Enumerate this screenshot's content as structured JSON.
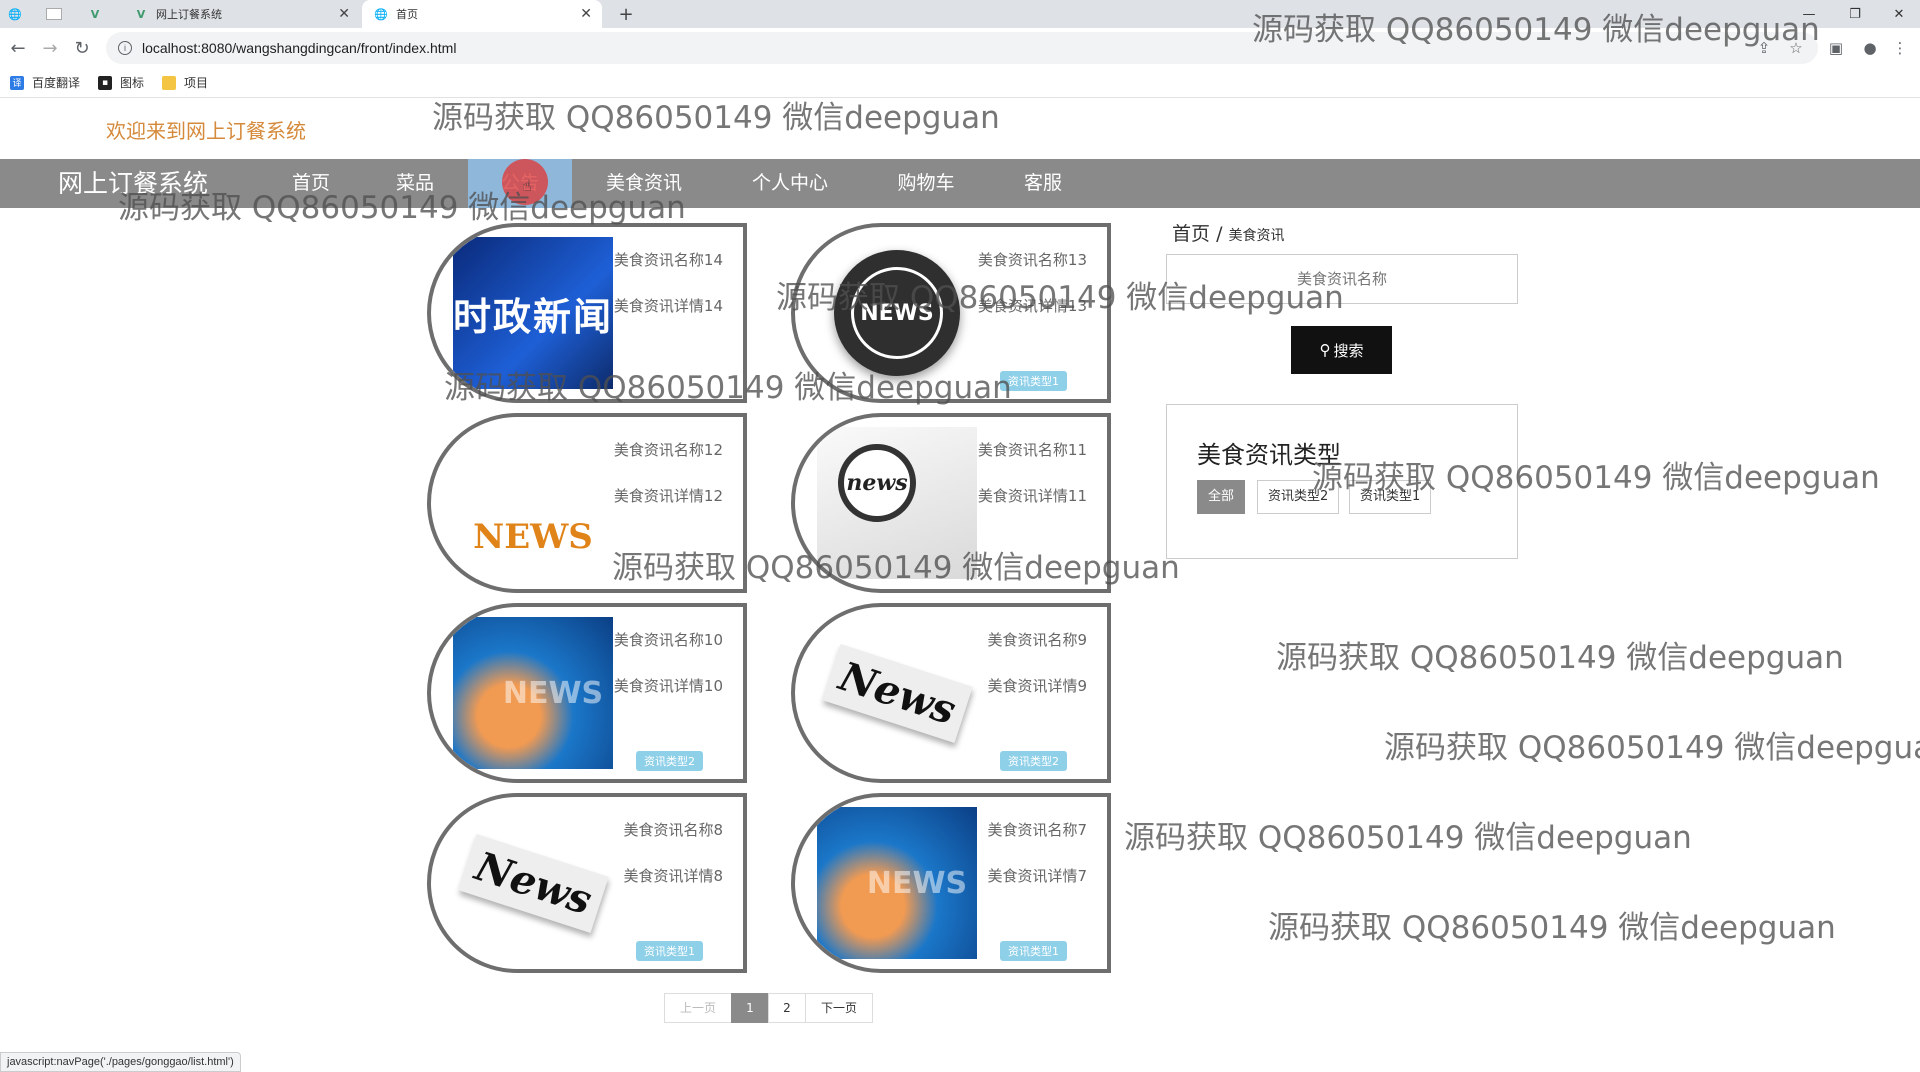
{
  "browser": {
    "tabs": [
      {
        "label": ""
      },
      {
        "label": ""
      },
      {
        "label": ""
      },
      {
        "label": "网上订餐系统"
      },
      {
        "label": "首页"
      }
    ],
    "url": "localhost:8080/wangshangdingcan/front/index.html",
    "bookmarks": [
      {
        "label": "百度翻译"
      },
      {
        "label": "图标"
      },
      {
        "label": "项目"
      }
    ],
    "status_text": "javascript:navPage('./pages/gonggao/list.html')"
  },
  "header": {
    "welcome": "欢迎来到网上订餐系统",
    "brand": "网上订餐系统",
    "nav": [
      {
        "label": "首页"
      },
      {
        "label": "菜品"
      },
      {
        "label": "公告"
      },
      {
        "label": "美食资讯"
      },
      {
        "label": "个人中心"
      },
      {
        "label": "购物车"
      },
      {
        "label": "客服"
      }
    ]
  },
  "news": [
    {
      "name": "美食资讯名称14",
      "detail": "美食资讯详情14",
      "type": "",
      "image": "时政新闻"
    },
    {
      "name": "美食资讯名称13",
      "detail": "美食资讯详情13",
      "type": "资讯类型1",
      "image": "NEWS"
    },
    {
      "name": "美食资讯名称12",
      "detail": "美食资讯详情12",
      "type": "",
      "image": "NEWS"
    },
    {
      "name": "美食资讯名称11",
      "detail": "美食资讯详情11",
      "type": "",
      "image": "news"
    },
    {
      "name": "美食资讯名称10",
      "detail": "美食资讯详情10",
      "type": "资讯类型2",
      "image": "NEWS"
    },
    {
      "name": "美食资讯名称9",
      "detail": "美食资讯详情9",
      "type": "资讯类型2",
      "image": "News"
    },
    {
      "name": "美食资讯名称8",
      "detail": "美食资讯详情8",
      "type": "资讯类型1",
      "image": "News"
    },
    {
      "name": "美食资讯名称7",
      "detail": "美食资讯详情7",
      "type": "资讯类型1",
      "image": "NEWS"
    }
  ],
  "sidebar": {
    "breadcrumb_home": "首页",
    "breadcrumb_sep": "/",
    "breadcrumb_current": "美食资讯",
    "search_placeholder": "美食资讯名称",
    "search_button": "搜索",
    "type_title": "美食资讯类型",
    "types": [
      {
        "label": "全部"
      },
      {
        "label": "资讯类型2"
      },
      {
        "label": "资讯类型1"
      }
    ]
  },
  "pagination": {
    "prev": "上一页",
    "pages": [
      "1",
      "2"
    ],
    "current": "1",
    "next": "下一页"
  },
  "watermark": "源码获取 QQ86050149 微信deepguan",
  "colors": {
    "nav_bg": "#8a8a8a",
    "nav_active": "#8fb7d9",
    "welcome": "#d58a3b",
    "type_badge": "#8fd0e9"
  }
}
